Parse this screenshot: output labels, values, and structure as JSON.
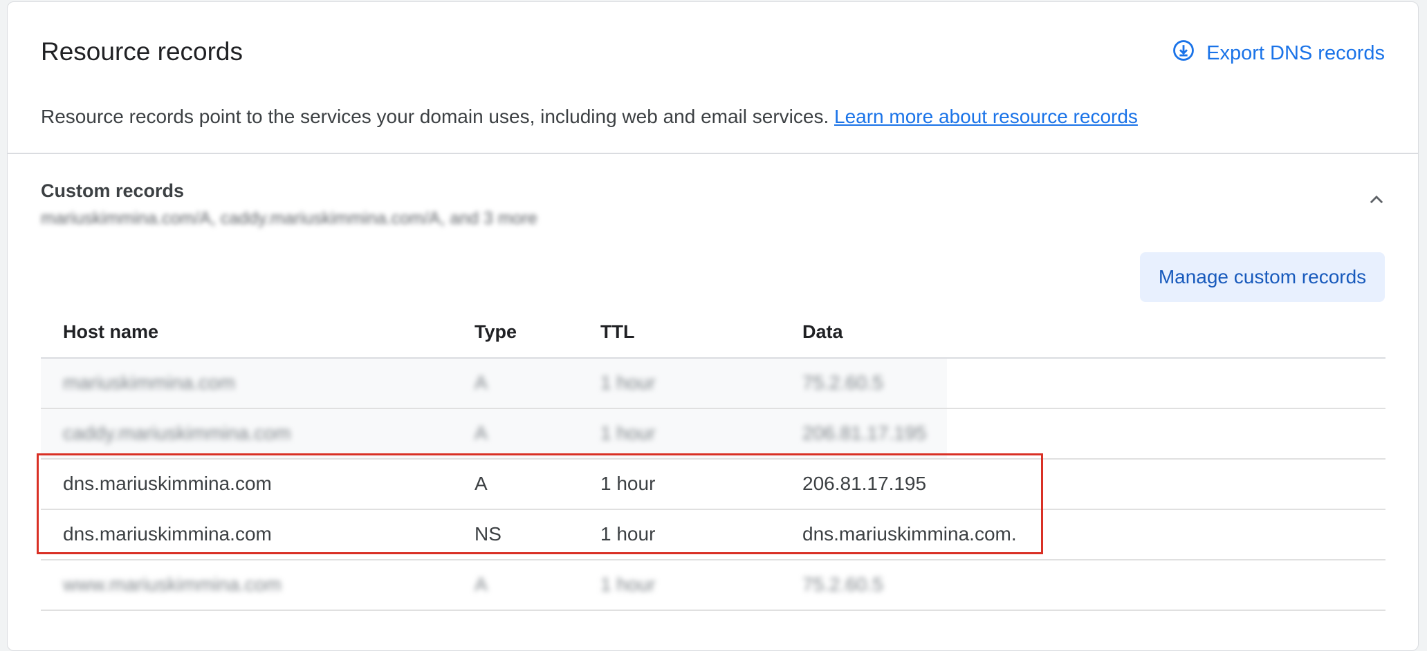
{
  "header": {
    "title": "Resource records",
    "export_label": "Export DNS records",
    "description": "Resource records point to the services your domain uses, including web and email services.",
    "learn_more": "Learn more about resource records"
  },
  "custom_records": {
    "title": "Custom records",
    "summary": "mariuskimmina.com/A, caddy.mariuskimmina.com/A, and 3 more",
    "manage_label": "Manage custom records"
  },
  "table": {
    "columns": [
      "Host name",
      "Type",
      "TTL",
      "Data"
    ],
    "rows": [
      {
        "host": "mariuskimmina.com",
        "type": "A",
        "ttl": "1 hour",
        "data": "75.2.60.5",
        "blurred": true
      },
      {
        "host": "caddy.mariuskimmina.com",
        "type": "A",
        "ttl": "1 hour",
        "data": "206.81.17.195",
        "blurred": true
      },
      {
        "host": "dns.mariuskimmina.com",
        "type": "A",
        "ttl": "1 hour",
        "data": "206.81.17.195",
        "blurred": false
      },
      {
        "host": "dns.mariuskimmina.com",
        "type": "NS",
        "ttl": "1 hour",
        "data": "dns.mariuskimmina.com.",
        "blurred": false
      },
      {
        "host": "www.mariuskimmina.com",
        "type": "A",
        "ttl": "1 hour",
        "data": "75.2.60.5",
        "blurred": true
      }
    ]
  },
  "icons": {
    "export": "download-circle-icon",
    "collapse": "chevron-up-icon"
  },
  "colors": {
    "accent": "#1a73e8",
    "highlight": "#d93025",
    "button_bg": "#e8f0fe"
  }
}
